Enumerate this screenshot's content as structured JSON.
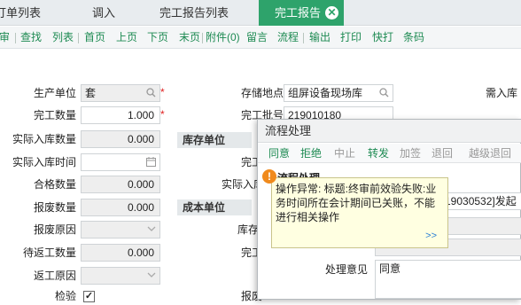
{
  "tabs": [
    {
      "label": "订单列表"
    },
    {
      "label": "调入"
    },
    {
      "label": "完工报告列表"
    },
    {
      "label": "完工报告"
    }
  ],
  "tab_close": "✕",
  "toolbar": {
    "items": [
      "审",
      "查找",
      "列表",
      "首页",
      "上页",
      "下页",
      "末页",
      "附件(0)",
      "留言",
      "流程",
      "输出",
      "打印",
      "快打",
      "条码"
    ]
  },
  "form": {
    "unit_label": "生产单位",
    "unit_value": "套",
    "qty_label": "完工数量",
    "qty_value": "1.000",
    "actual_in_qty_label": "实际入库数量",
    "actual_in_qty_value": "0.000",
    "actual_in_time_label": "实际入库时间",
    "pass_qty_label": "合格数量",
    "pass_qty_value": "0.000",
    "scrap_qty_label": "报废数量",
    "scrap_qty_value": "0.000",
    "scrap_reason_label": "报废原因",
    "rework_qty_label": "待返工数量",
    "rework_qty_value": "0.000",
    "rework_reason_label": "返工原因",
    "inspect_label": "检验",
    "inspect_checked": "✓",
    "storage_label": "存储地点",
    "storage_value": "组屏设备现场库",
    "report_no_label": "完工批号",
    "report_no_value": "219010180",
    "need_in_label": "需入库",
    "stock_unit_section": "库存单位",
    "cost_unit_section": "成本单位",
    "col3_labels": [
      "完工",
      "实际入库",
      "库存",
      "完工",
      "报废"
    ]
  },
  "dialog": {
    "title": "流程处理",
    "toolbar": [
      {
        "label": "同意",
        "enabled": true
      },
      {
        "label": "拒绝",
        "enabled": true
      },
      {
        "label": "中止",
        "enabled": false
      },
      {
        "label": "转发",
        "enabled": true
      },
      {
        "label": "加签",
        "enabled": false
      },
      {
        "label": "退回",
        "enabled": false
      },
      {
        "label": "越级退回",
        "enabled": false
      }
    ],
    "section_label": "流程处理",
    "partial_value": "19030532]发起",
    "opinion_label": "处理意见",
    "opinion_value": "同意"
  },
  "tooltip": {
    "text": "操作异常: 标题:终审前效验失败:业务时间所在会计期间已关账，不能进行相关操作",
    "more": ">>"
  }
}
